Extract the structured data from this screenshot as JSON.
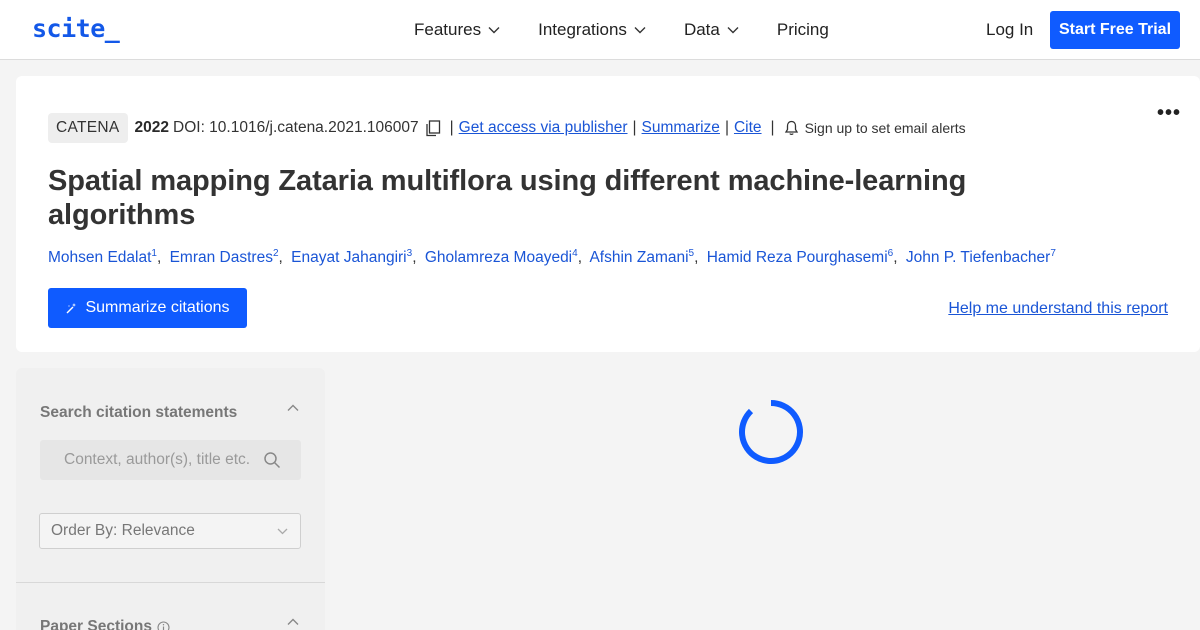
{
  "header": {
    "logo": "scite_",
    "nav": [
      {
        "label": "Features",
        "has_dropdown": true
      },
      {
        "label": "Integrations",
        "has_dropdown": true
      },
      {
        "label": "Data",
        "has_dropdown": true
      },
      {
        "label": "Pricing",
        "has_dropdown": false
      }
    ],
    "login_label": "Log In",
    "trial_label": "Start Free Trial"
  },
  "paper": {
    "journal": "CATENA",
    "year": "2022",
    "doi": "DOI: 10.1016/j.catena.2021.106007",
    "links": {
      "access": "Get access via publisher",
      "summarize": "Summarize",
      "cite": "Cite",
      "separator": "|"
    },
    "alerts": "Sign up to set email alerts",
    "more_icon": "•••",
    "title": "Spatial mapping Zataria multiflora using different machine-learning algorithms",
    "authors": [
      {
        "name": "Mohsen Edalat",
        "sup": "1"
      },
      {
        "name": "Emran Dastres",
        "sup": "2"
      },
      {
        "name": "Enayat Jahangiri",
        "sup": "3"
      },
      {
        "name": "Gholamreza Moayedi",
        "sup": "4"
      },
      {
        "name": "Afshin Zamani",
        "sup": "5"
      },
      {
        "name": "Hamid Reza Pourghasemi",
        "sup": "6"
      },
      {
        "name": "John P. Tiefenbacher",
        "sup": "7"
      }
    ],
    "summarize_button": "Summarize citations",
    "help_link": "Help me understand this report"
  },
  "sidebar": {
    "search_heading": "Search citation statements",
    "search_placeholder": "Context, author(s), title etc.",
    "order_by": "Order By: Relevance",
    "sections_heading": "Paper Sections"
  },
  "colors": {
    "brand": "#1358e8",
    "button": "#0f5bff",
    "link": "#1a55d6",
    "spinner": "#0f5bff"
  }
}
